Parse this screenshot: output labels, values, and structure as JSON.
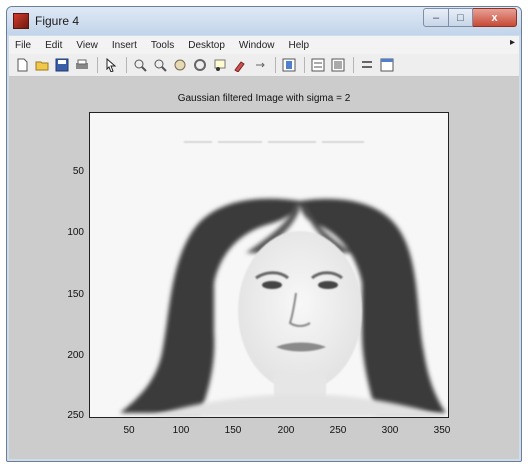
{
  "window": {
    "title": "Figure 4",
    "minimize_glyph": "–",
    "maximize_glyph": "□",
    "close_glyph": "x"
  },
  "menubar": {
    "items": [
      "File",
      "Edit",
      "View",
      "Insert",
      "Tools",
      "Desktop",
      "Window",
      "Help"
    ],
    "overflow_glyph": "▸"
  },
  "toolbar": {
    "icons": [
      "new-figure-icon",
      "open-file-icon",
      "save-icon",
      "print-icon",
      "edit-plot-arrow-icon",
      "zoom-in-icon",
      "zoom-out-icon",
      "pan-icon",
      "rotate-3d-icon",
      "data-cursor-icon",
      "brush-icon",
      "link-plot-icon",
      "colorbar-icon",
      "legend-icon",
      "hide-plot-tools-icon",
      "show-plot-tools-icon"
    ]
  },
  "plot": {
    "title": "Gaussian filtered Image with sigma = 2",
    "xticks": [
      "50",
      "100",
      "150",
      "200",
      "250",
      "300",
      "350"
    ],
    "yticks": [
      "50",
      "100",
      "150",
      "200",
      "250"
    ]
  },
  "colors": {
    "titlebar": "#c2d4ea",
    "canvas": "#cccccc",
    "close_button": "#c74a37"
  }
}
